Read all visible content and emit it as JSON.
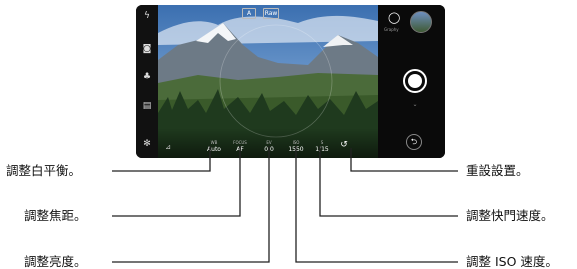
{
  "camera": {
    "top_controls": [
      "A",
      "Raw"
    ],
    "manual_controls": [
      {
        "label": "WB",
        "value": "Auto"
      },
      {
        "label": "FOCUS",
        "value": "AF"
      },
      {
        "label": "EV",
        "value": "0.0"
      },
      {
        "label": "ISO",
        "value": "1550"
      },
      {
        "label": "S",
        "value": "1/15"
      }
    ],
    "right_label": "Graphy"
  },
  "callouts": {
    "white_balance": "調整白平衡。",
    "focus": "調整焦距。",
    "brightness": "調整亮度。",
    "reset": "重設設置。",
    "shutter": "調整快門速度。",
    "iso": "調整 ISO 速度。"
  },
  "colors": {
    "line": "#222222",
    "shutter_ring": "#ffffff"
  }
}
